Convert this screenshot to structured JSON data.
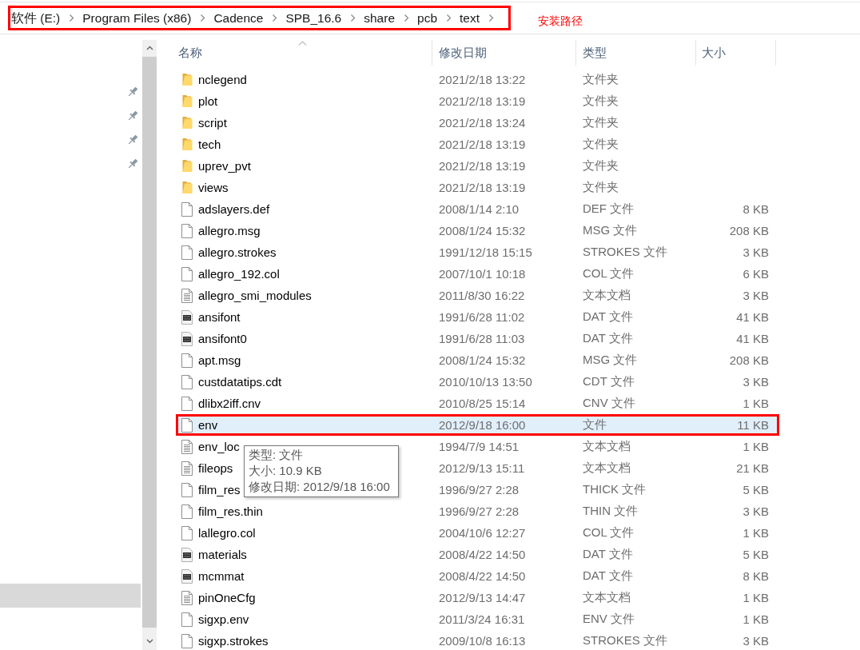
{
  "address_bar": {
    "segments": [
      "软件 (E:)",
      "Program Files (x86)",
      "Cadence",
      "SPB_16.6",
      "share",
      "pcb",
      "text"
    ],
    "outlined": true
  },
  "annotation": "安装路径",
  "nav_pane": {
    "pinned_items": [
      {
        "pinned": true
      },
      {
        "pinned": true
      },
      {
        "pinned": true
      },
      {
        "pinned": true
      }
    ],
    "current_item": {
      "selected": true
    }
  },
  "columns": [
    {
      "label": "名称",
      "sorted": true
    },
    {
      "label": "修改日期",
      "sorted": false
    },
    {
      "label": "类型",
      "sorted": false
    },
    {
      "label": "大小",
      "sorted": false
    }
  ],
  "rows": [
    {
      "kind": "folder",
      "name": "nclegend",
      "date": "2021/2/18 13:22",
      "type": "文件夹",
      "selected": false,
      "outlined": false
    },
    {
      "kind": "folder",
      "name": "plot",
      "date": "2021/2/18 13:19",
      "type": "文件夹",
      "selected": false,
      "outlined": false
    },
    {
      "kind": "folder",
      "name": "script",
      "date": "2021/2/18 13:24",
      "type": "文件夹",
      "selected": false,
      "outlined": false
    },
    {
      "kind": "folder",
      "name": "tech",
      "date": "2021/2/18 13:19",
      "type": "文件夹",
      "selected": false,
      "outlined": false
    },
    {
      "kind": "folder",
      "name": "uprev_pvt",
      "date": "2021/2/18 13:19",
      "type": "文件夹",
      "selected": false,
      "outlined": false
    },
    {
      "kind": "folder",
      "name": "views",
      "date": "2021/2/18 13:19",
      "type": "文件夹",
      "selected": false,
      "outlined": false
    },
    {
      "kind": "file",
      "name": "adslayers.def",
      "date": "2008/1/14 2:10",
      "type": "DEF 文件",
      "size": "8 KB",
      "selected": false,
      "outlined": false
    },
    {
      "kind": "file",
      "name": "allegro.msg",
      "date": "2008/1/24 15:32",
      "type": "MSG 文件",
      "size": "208 KB",
      "selected": false,
      "outlined": false
    },
    {
      "kind": "file",
      "name": "allegro.strokes",
      "date": "1991/12/18 15:15",
      "type": "STROKES 文件",
      "size": "3 KB",
      "selected": false,
      "outlined": false
    },
    {
      "kind": "file",
      "name": "allegro_192.col",
      "date": "2007/10/1 10:18",
      "type": "COL 文件",
      "size": "6 KB",
      "selected": false,
      "outlined": false
    },
    {
      "kind": "text",
      "name": "allegro_smi_modules",
      "date": "2011/8/30 16:22",
      "type": "文本文档",
      "size": "3 KB",
      "selected": false,
      "outlined": false
    },
    {
      "kind": "dat",
      "name": "ansifont",
      "date": "1991/6/28 11:02",
      "type": "DAT 文件",
      "size": "41 KB",
      "selected": false,
      "outlined": false
    },
    {
      "kind": "dat",
      "name": "ansifont0",
      "date": "1991/6/28 11:03",
      "type": "DAT 文件",
      "size": "41 KB",
      "selected": false,
      "outlined": false
    },
    {
      "kind": "file",
      "name": "apt.msg",
      "date": "2008/1/24 15:32",
      "type": "MSG 文件",
      "size": "208 KB",
      "selected": false,
      "outlined": false
    },
    {
      "kind": "file",
      "name": "custdatatips.cdt",
      "date": "2010/10/13 13:50",
      "type": "CDT 文件",
      "size": "3 KB",
      "selected": false,
      "outlined": false
    },
    {
      "kind": "file",
      "name": "dlibx2iff.cnv",
      "date": "2010/8/25 15:14",
      "type": "CNV 文件",
      "size": "1 KB",
      "selected": false,
      "outlined": false
    },
    {
      "kind": "file",
      "name": "env",
      "date": "2012/9/18 16:00",
      "type": "文件",
      "size": "11 KB",
      "selected": true,
      "outlined": true
    },
    {
      "kind": "text",
      "name": "env_loc",
      "date": "1994/7/9 14:51",
      "type": "文本文档",
      "size": "1 KB",
      "selected": false,
      "outlined": false
    },
    {
      "kind": "text",
      "name": "fileops",
      "date": "2012/9/13 15:11",
      "type": "文本文档",
      "size": "21 KB",
      "selected": false,
      "outlined": false
    },
    {
      "kind": "file",
      "name": "film_res",
      "date": "1996/9/27 2:28",
      "type": "THICK 文件",
      "size": "5 KB",
      "selected": false,
      "outlined": false
    },
    {
      "kind": "file",
      "name": "film_res.thin",
      "date": "1996/9/27 2:28",
      "type": "THIN 文件",
      "size": "3 KB",
      "selected": false,
      "outlined": false
    },
    {
      "kind": "file",
      "name": "lallegro.col",
      "date": "2004/10/6 12:27",
      "type": "COL 文件",
      "size": "1 KB",
      "selected": false,
      "outlined": false
    },
    {
      "kind": "dat",
      "name": "materials",
      "date": "2008/4/22 14:50",
      "type": "DAT 文件",
      "size": "5 KB",
      "selected": false,
      "outlined": false
    },
    {
      "kind": "dat",
      "name": "mcmmat",
      "date": "2008/4/22 14:50",
      "type": "DAT 文件",
      "size": "8 KB",
      "selected": false,
      "outlined": false
    },
    {
      "kind": "text",
      "name": "pinOneCfg",
      "date": "2012/9/13 14:47",
      "type": "文本文档",
      "size": "1 KB",
      "selected": false,
      "outlined": false
    },
    {
      "kind": "file",
      "name": "sigxp.env",
      "date": "2011/3/24 16:31",
      "type": "ENV 文件",
      "size": "1 KB",
      "selected": false,
      "outlined": false
    },
    {
      "kind": "file",
      "name": "sigxp.strokes",
      "date": "2009/10/8 16:13",
      "type": "STROKES 文件",
      "size": "3 KB",
      "selected": false,
      "outlined": false
    }
  ],
  "tooltip": {
    "lines": [
      "类型: 文件",
      "大小: 10.9 KB",
      "修改日期: 2012/9/18 16:00"
    ]
  }
}
